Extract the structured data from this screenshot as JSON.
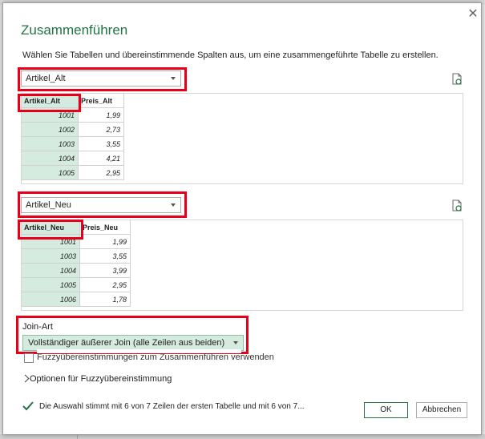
{
  "dialog": {
    "title": "Zusammenführen",
    "instruction": "Wählen Sie Tabellen und übereinstimmende Spalten aus, um eine zusammengeführte Tabelle zu erstellen.",
    "close_symbol": "✕"
  },
  "table1": {
    "selected": "Artikel_Alt",
    "headers": [
      "Artikel_Alt",
      "Preis_Alt"
    ],
    "rows": [
      [
        "1001",
        "1,99"
      ],
      [
        "1002",
        "2,73"
      ],
      [
        "1003",
        "3,55"
      ],
      [
        "1004",
        "4,21"
      ],
      [
        "1005",
        "2,95"
      ]
    ]
  },
  "table2": {
    "selected": "Artikel_Neu",
    "headers": [
      "Artikel_Neu",
      "Preis_Neu"
    ],
    "rows": [
      [
        "1001",
        "1,99"
      ],
      [
        "1003",
        "3,55"
      ],
      [
        "1004",
        "3,99"
      ],
      [
        "1005",
        "2,95"
      ],
      [
        "1006",
        "1,78"
      ]
    ]
  },
  "join": {
    "label": "Join-Art",
    "selected": "Vollständiger äußerer Join (alle Zeilen aus beiden)"
  },
  "fuzzy": {
    "checkbox_label": "Fuzzyübereinstimmungen zum Zusammenführen verwenden",
    "options_label": "Optionen für Fuzzyübereinstimmung"
  },
  "status": {
    "text": "Die Auswahl stimmt mit 6 von 7 Zeilen der ersten Tabelle und mit 6 von 7..."
  },
  "buttons": {
    "ok": "OK",
    "cancel": "Abbrechen"
  },
  "icons": {
    "refresh": "refresh-icon",
    "close": "close-icon",
    "check": "check-icon",
    "chevron": "chevron-right-icon"
  },
  "colors": {
    "accent": "#217346",
    "key_column_bg": "#d6ebdf",
    "highlight": "#e8001a"
  }
}
